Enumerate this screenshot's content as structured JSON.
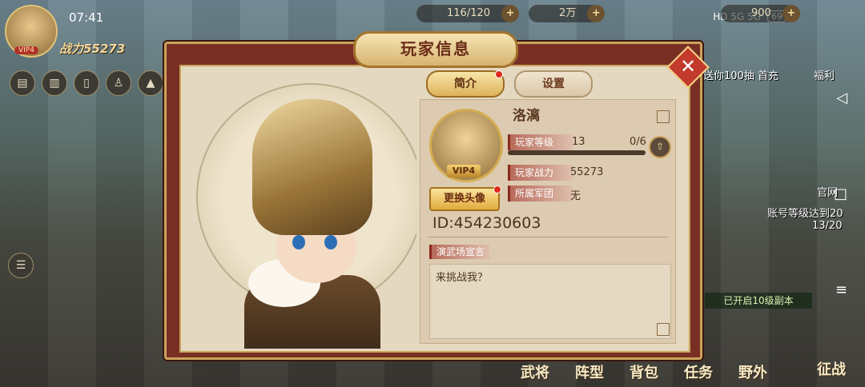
{
  "status_bar": {
    "time": "07:41",
    "network": "HD 5G 5G",
    "battery": "69"
  },
  "hud": {
    "vip": "VIP4",
    "power": "战力55273",
    "resources": [
      {
        "value": "116/120"
      },
      {
        "value": "2万"
      },
      {
        "value": "900"
      }
    ],
    "side_texts": {
      "recharge": "送你100抽 首充",
      "welfare": "福利",
      "official": "官网",
      "task_banner": "账号等级达到20",
      "task_progress": "13/20",
      "stage_notice": "已开启10级副本"
    }
  },
  "bottom_nav": [
    "武将",
    "阵型",
    "背包",
    "任务",
    "野外"
  ],
  "campaign_label": "征战",
  "dialog": {
    "title": "玩家信息",
    "close": "✕",
    "tabs": [
      {
        "label": "简介"
      },
      {
        "label": "设置"
      }
    ],
    "profile": {
      "name": "洛漓",
      "vip": "VIP4",
      "level_label": "玩家等级",
      "level": "13",
      "level_progress": "0/6",
      "level_progress_fraction": 0.0,
      "power_label": "玩家战力",
      "power": "55273",
      "legion_label": "所属军团",
      "legion": "无",
      "change_avatar": "更换头像",
      "id_text": "ID:454230603",
      "declaration_label": "演武场宣言",
      "declaration": "来挑战我？"
    }
  },
  "colors": {
    "accent_red": "#7a2f24",
    "gold": "#c9a45a",
    "panel": "#e5d8c0"
  }
}
